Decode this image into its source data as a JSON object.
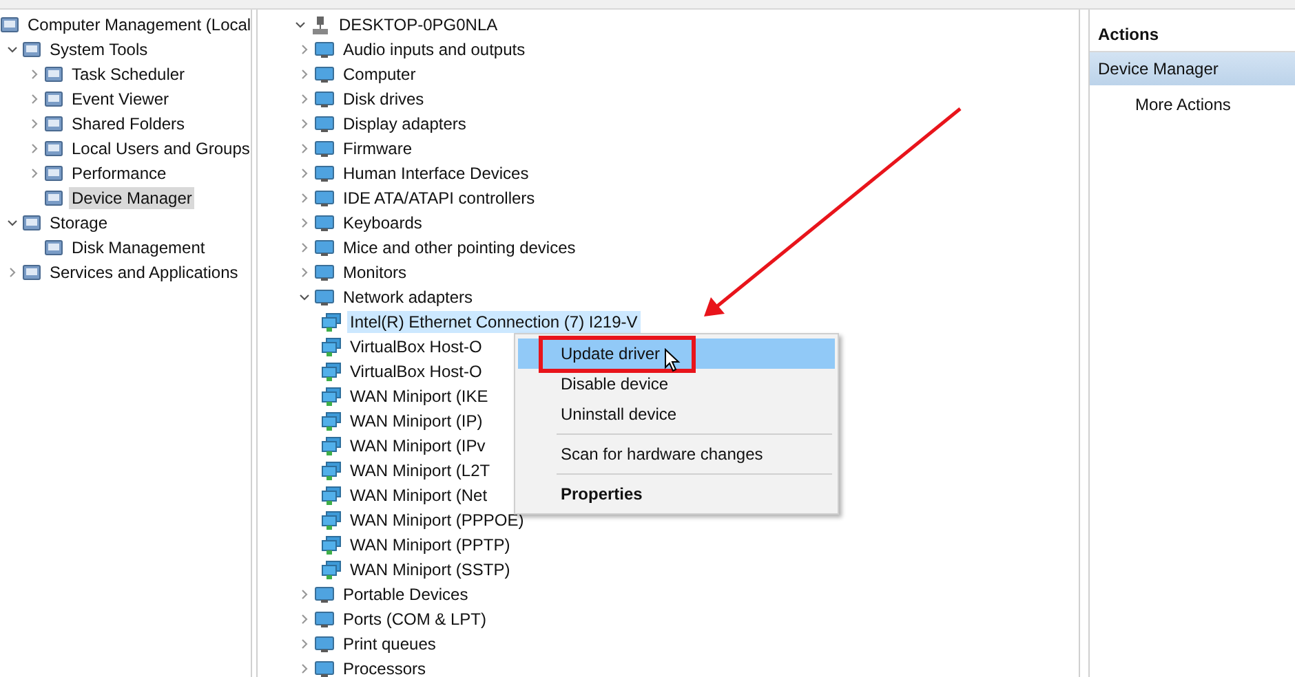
{
  "console_tree": [
    {
      "label": "Computer Management (Local",
      "selected": false,
      "children": [
        {
          "label": "System Tools",
          "expanded": true,
          "selected": false,
          "children": [
            {
              "label": "Task Scheduler",
              "expanded": false,
              "selected": false
            },
            {
              "label": "Event Viewer",
              "expanded": false,
              "selected": false
            },
            {
              "label": "Shared Folders",
              "expanded": false,
              "selected": false
            },
            {
              "label": "Local Users and Groups",
              "expanded": false,
              "selected": false
            },
            {
              "label": "Performance",
              "expanded": false,
              "selected": false
            },
            {
              "label": "Device Manager",
              "selected": true
            }
          ]
        },
        {
          "label": "Storage",
          "expanded": true,
          "selected": false,
          "children": [
            {
              "label": "Disk Management",
              "selected": false
            }
          ]
        },
        {
          "label": "Services and Applications",
          "expanded": false,
          "selected": false
        }
      ]
    }
  ],
  "device_tree": [
    {
      "label": "DESKTOP-0PG0NLA",
      "expanded": true,
      "selected": false,
      "children": [
        {
          "label": "Audio inputs and outputs",
          "expanded": false,
          "selected": false
        },
        {
          "label": "Computer",
          "expanded": false,
          "selected": false
        },
        {
          "label": "Disk drives",
          "expanded": false,
          "selected": false
        },
        {
          "label": "Display adapters",
          "expanded": false,
          "selected": false
        },
        {
          "label": "Firmware",
          "expanded": false,
          "selected": false
        },
        {
          "label": "Human Interface Devices",
          "expanded": false,
          "selected": false
        },
        {
          "label": "IDE ATA/ATAPI controllers",
          "expanded": false,
          "selected": false
        },
        {
          "label": "Keyboards",
          "expanded": false,
          "selected": false
        },
        {
          "label": "Mice and other pointing devices",
          "expanded": false,
          "selected": false
        },
        {
          "label": "Monitors",
          "expanded": false,
          "selected": false
        },
        {
          "label": "Network adapters",
          "expanded": true,
          "selected": false,
          "children": [
            {
              "label": "Intel(R) Ethernet Connection (7) I219-V",
              "selected": true
            },
            {
              "label": "VirtualBox Host-O",
              "selected": false
            },
            {
              "label": "VirtualBox Host-O",
              "selected": false
            },
            {
              "label": "WAN Miniport (IKE",
              "selected": false
            },
            {
              "label": "WAN Miniport (IP)",
              "selected": false
            },
            {
              "label": "WAN Miniport (IPv",
              "selected": false
            },
            {
              "label": "WAN Miniport (L2T",
              "selected": false
            },
            {
              "label": "WAN Miniport (Net",
              "selected": false
            },
            {
              "label": "WAN Miniport (PPPOE)",
              "selected": false
            },
            {
              "label": "WAN Miniport (PPTP)",
              "selected": false
            },
            {
              "label": "WAN Miniport (SSTP)",
              "selected": false
            }
          ]
        },
        {
          "label": "Portable Devices",
          "expanded": false,
          "selected": false
        },
        {
          "label": "Ports (COM & LPT)",
          "expanded": false,
          "selected": false
        },
        {
          "label": "Print queues",
          "expanded": false,
          "selected": false
        },
        {
          "label": "Processors",
          "expanded": false,
          "selected": false
        }
      ]
    }
  ],
  "context_menu": {
    "groups": [
      [
        {
          "label": "Update driver",
          "selected": true,
          "default": false
        },
        {
          "label": "Disable device",
          "selected": false,
          "default": false
        },
        {
          "label": "Uninstall device",
          "selected": false,
          "default": false
        }
      ],
      [
        {
          "label": "Scan for hardware changes",
          "selected": false,
          "default": false
        }
      ],
      [
        {
          "label": "Properties",
          "selected": false,
          "default": true
        }
      ]
    ]
  },
  "actions_pane": {
    "title": "Actions",
    "items": [
      {
        "label": "Device Manager",
        "kind": "heading"
      },
      {
        "label": "More Actions",
        "kind": "action"
      }
    ]
  }
}
